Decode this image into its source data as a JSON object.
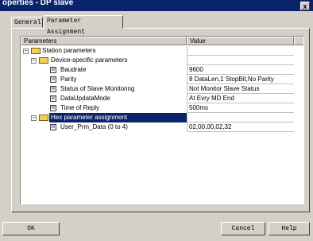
{
  "window": {
    "title": "operties - DP slave",
    "close_label": "x"
  },
  "tabs": [
    {
      "label": "General"
    },
    {
      "label": "Parameter Assignment"
    }
  ],
  "columns": {
    "parameters": "Parameters",
    "value": "Value"
  },
  "tree": [
    {
      "label": "Station parameters",
      "value": ""
    },
    {
      "label": "Device-specific parameters",
      "value": ""
    },
    {
      "label": "Baudrate",
      "value": "9600"
    },
    {
      "label": "Parity",
      "value": "8 DataLen,1 StopBit,No Parity"
    },
    {
      "label": "Status of Slave Monitoring",
      "value": "Not Monitor Slave Status"
    },
    {
      "label": "DataUpdataMode",
      "value": "At Evry MD End"
    },
    {
      "label": "Time of Reply",
      "value": "500ms"
    },
    {
      "label": "Hex parameter assignment",
      "value": ""
    },
    {
      "label": "User_Prm_Data (0 to 4)",
      "value": "02,00,00,02,32"
    }
  ],
  "buttons": {
    "ok": "OK",
    "cancel": "Cancel",
    "help": "Help"
  },
  "icons": {
    "folder": "folder-open-icon",
    "param": "parameter-icon",
    "expand": "minus",
    "param_glyph": "W"
  }
}
